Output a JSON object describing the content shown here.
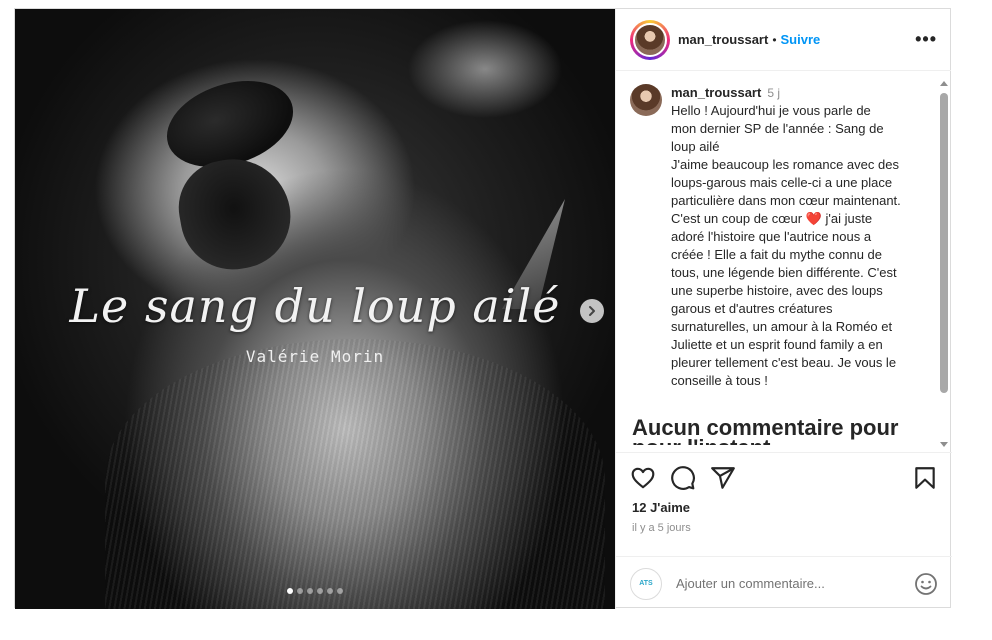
{
  "media": {
    "book_title": "Le sang du loup ailé",
    "book_author": "Valérie Morin",
    "carousel_dots": 6,
    "carousel_active_index": 0
  },
  "header": {
    "username": "man_troussart",
    "separator": "•",
    "follow_label": "Suivre",
    "more_label": "•••"
  },
  "caption": {
    "username": "man_troussart",
    "time": "5 j",
    "lines": [
      "Hello ! Aujourd'hui je vous parle de",
      "mon dernier SP de l'année : Sang de",
      "loup ailé",
      "J'aime beaucoup les romance avec des",
      "loups-garous mais celle-ci a une place",
      "particulière dans mon cœur maintenant.",
      "C'est un coup de cœur ❤️ j'ai juste",
      "adoré l'histoire que l'autrice nous a",
      "créée ! Elle a fait du mythe connu de",
      "tous, une légende bien différente. C'est",
      "une superbe histoire, avec des loups",
      "garous et d'autres créatures",
      "surnaturelles, un amour à la Roméo et",
      "Juliette et un esprit found family a en",
      "pleurer tellement c'est beau. Je vous le",
      "conseille à tous !"
    ]
  },
  "comments": {
    "empty_line1": "Aucun commentaire pour",
    "empty_line2": "pour l'instant."
  },
  "actions": {
    "likes": "12 J'aime",
    "date": "il y a 5 jours",
    "comment_placeholder": "Ajouter un commentaire...",
    "add_avatar_text": "ATS"
  },
  "colors": {
    "follow": "#0095f6",
    "secondary_text": "#8e8e8e",
    "border": "#dbdbdb"
  }
}
